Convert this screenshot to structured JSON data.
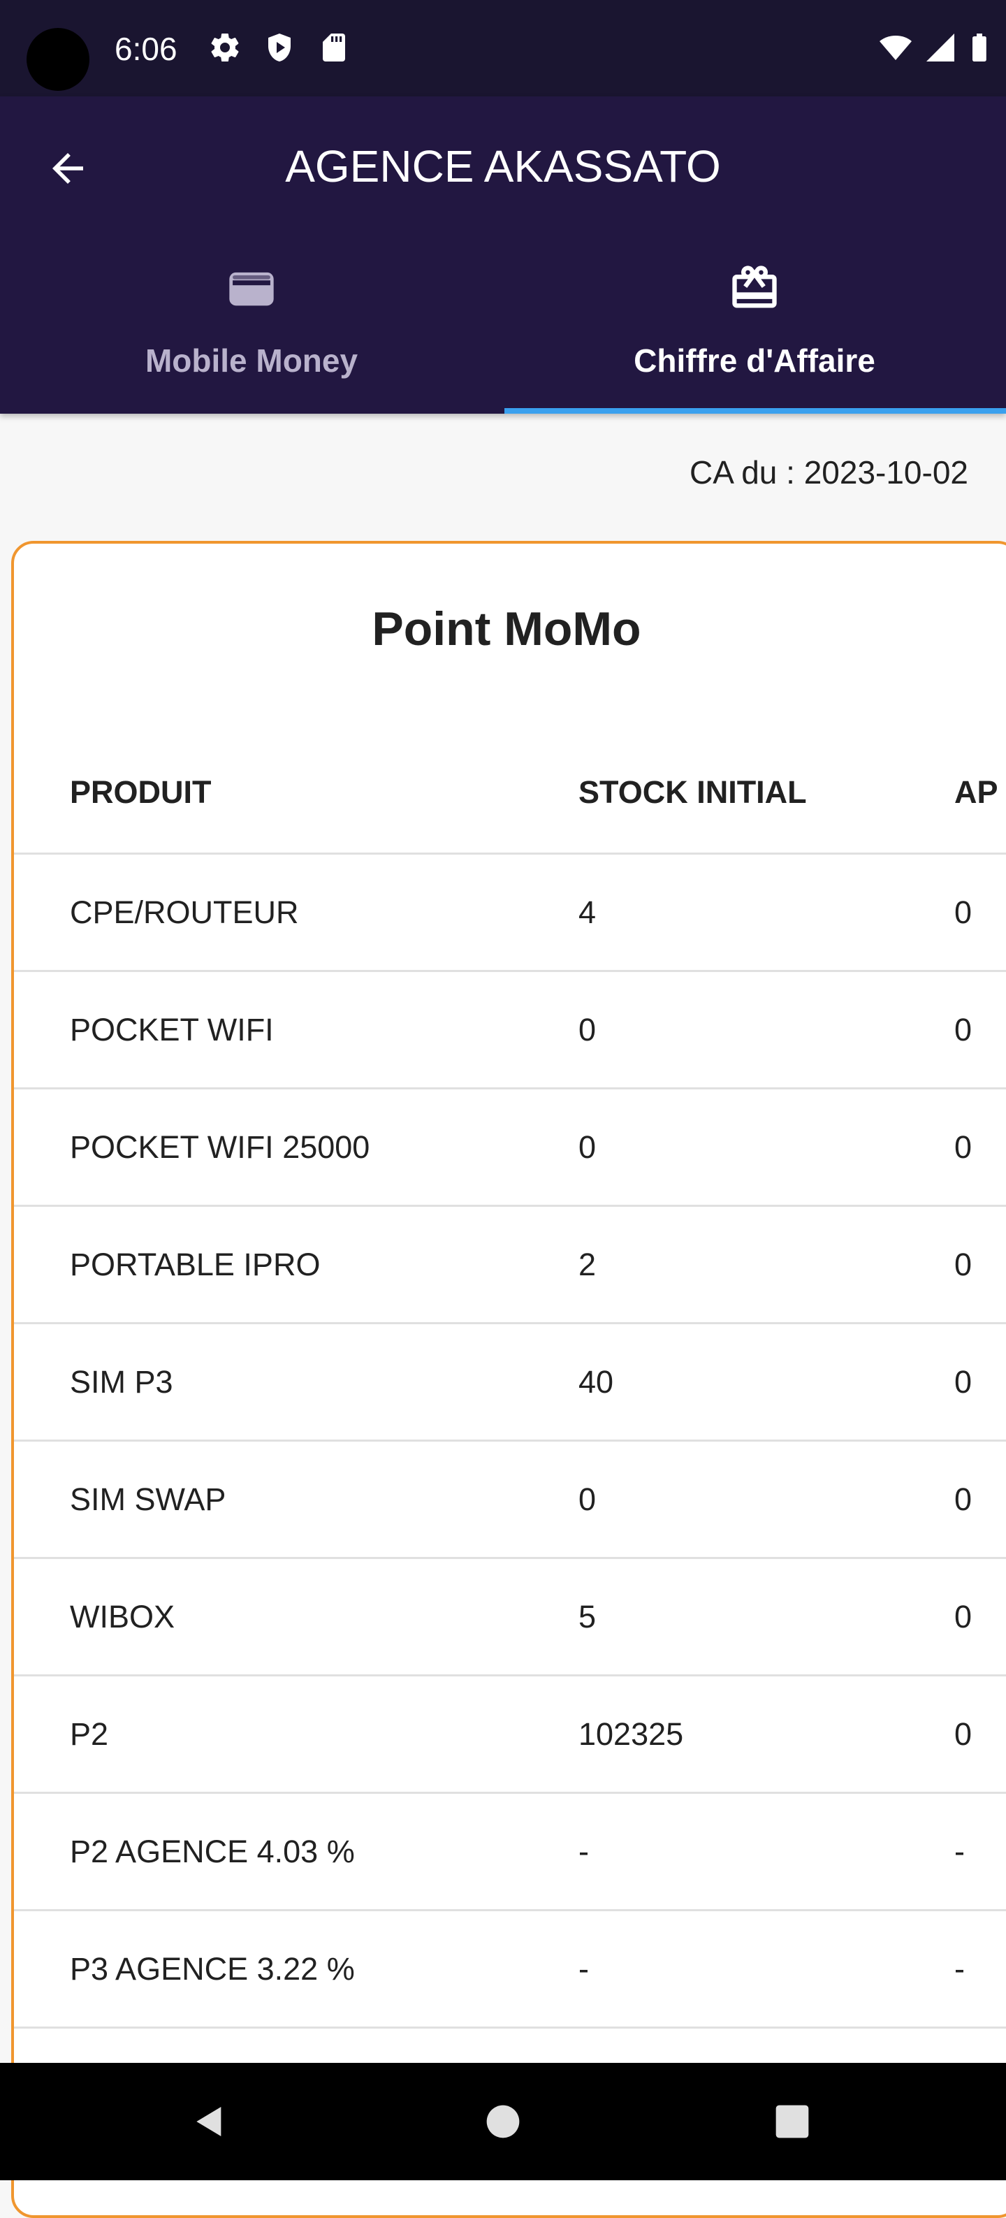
{
  "status_bar": {
    "time": "6:06",
    "icons": [
      "camera-cutout",
      "gear-icon",
      "shield-play-icon",
      "sd-card-icon",
      "wifi-icon",
      "signal-icon",
      "battery-icon"
    ]
  },
  "app_bar": {
    "title": "AGENCE AKASSATO",
    "back_icon": "arrow-left-icon",
    "tabs": [
      {
        "label": "Mobile Money",
        "icon": "wallet-icon",
        "selected": false
      },
      {
        "label": "Chiffre d'Affaire",
        "icon": "gift-icon",
        "selected": true
      }
    ],
    "colors": {
      "background": "#221741",
      "status_background": "#1a1530",
      "indicator": "#3aa0ee",
      "inactive_tab_text": "#b9b2cc",
      "active_tab_text": "#ffffff"
    }
  },
  "date_line": "CA du : 2023-10-02",
  "card": {
    "title": "Point MoMo",
    "border_color": "#f0962f",
    "columns": [
      "PRODUIT",
      "STOCK INITIAL",
      "AP"
    ],
    "rows": [
      [
        "CPE/ROUTEUR",
        "4",
        "0"
      ],
      [
        "POCKET WIFI",
        "0",
        "0"
      ],
      [
        "POCKET WIFI 25000",
        "0",
        "0"
      ],
      [
        "PORTABLE IPRO",
        "2",
        "0"
      ],
      [
        "SIM P3",
        "40",
        "0"
      ],
      [
        "SIM SWAP",
        "0",
        "0"
      ],
      [
        "WIBOX",
        "5",
        "0"
      ],
      [
        "P2",
        "102325",
        "0"
      ],
      [
        "P2 AGENCE 4.03 %",
        "-",
        "-"
      ],
      [
        "P3 AGENCE 3.22 %",
        "-",
        "-"
      ],
      [
        "",
        "",
        ""
      ]
    ]
  },
  "nav_bar": {
    "buttons": [
      "back-triangle-icon",
      "home-circle-icon",
      "recents-square-icon"
    ]
  }
}
